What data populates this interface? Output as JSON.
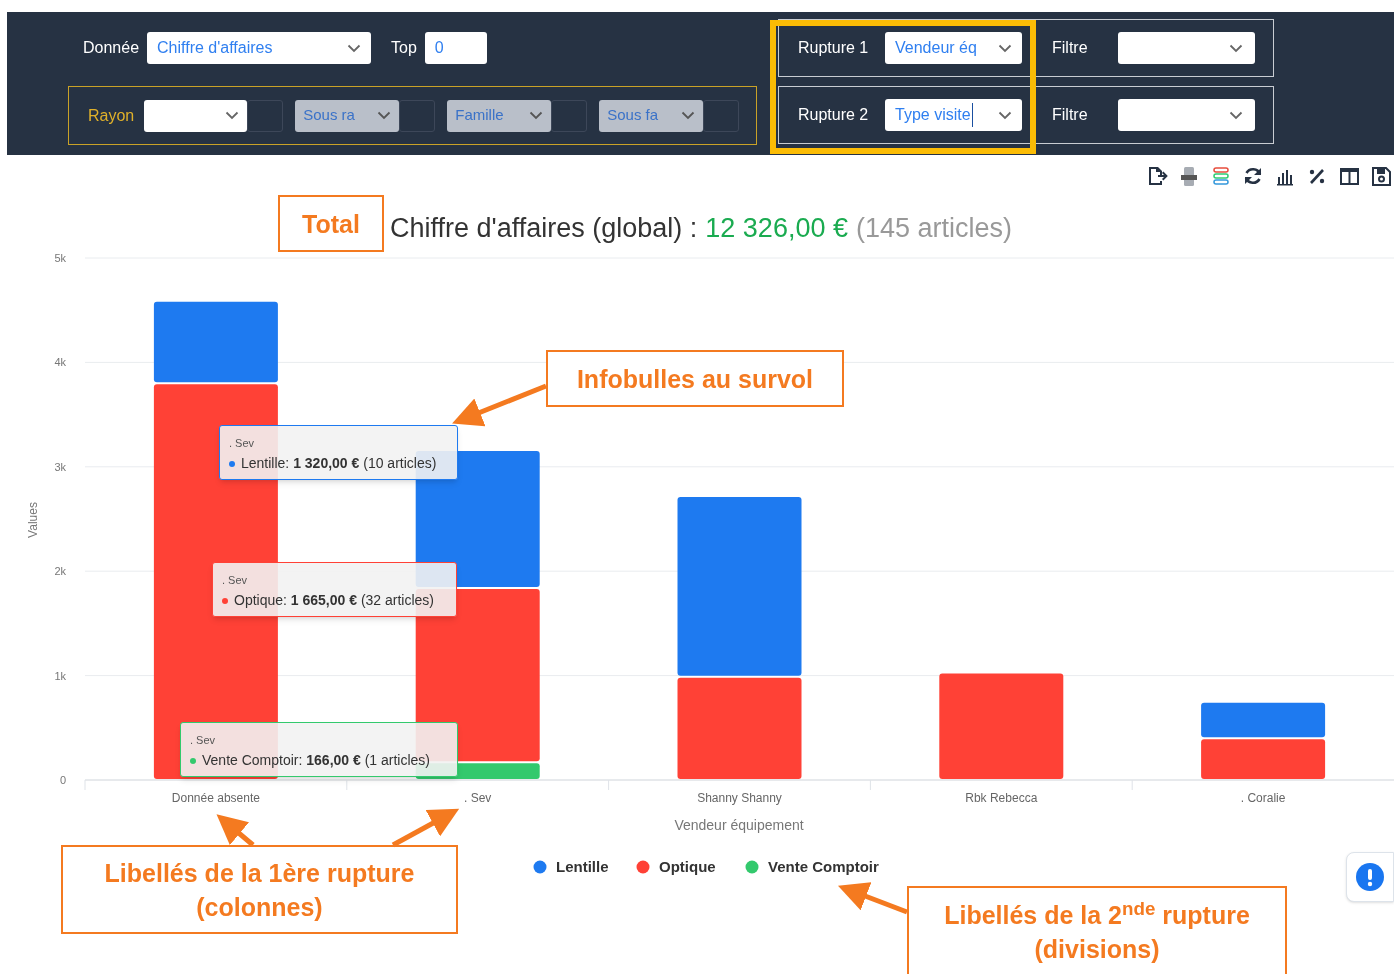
{
  "filters": {
    "donnee": {
      "label": "Donnée",
      "value": "Chiffre d'affaires"
    },
    "top": {
      "label": "Top",
      "value": "0"
    }
  },
  "hierarchy": {
    "label": "Rayon",
    "selects": [
      {
        "disabled": false
      },
      {
        "placeholder": "Sous ra",
        "disabled": true
      },
      {
        "placeholder": "Famille",
        "disabled": true
      },
      {
        "placeholder": "Sous fa",
        "disabled": true
      }
    ]
  },
  "ruptures": [
    {
      "label": "Rupture 1",
      "value": "Vendeur éq",
      "focused": false,
      "filter_label": "Filtre"
    },
    {
      "label": "Rupture 2",
      "value": "Type visite",
      "focused": true,
      "filter_label": "Filtre"
    }
  ],
  "chart": {
    "title": "Chiffre d'affaires (global) :",
    "amount": "12 326,00 €",
    "count": "(145 articles)",
    "chart_data": {
      "type": "bar",
      "stacked": true,
      "grid": true,
      "legend": true,
      "xlabel": "Vendeur équipement",
      "ylabel": "Values",
      "categories": [
        "Donnée absente",
        ". Sev",
        "Shanny Shanny",
        "Rbk Rebecca",
        ". Coralie"
      ],
      "ylim": [
        0,
        5000
      ],
      "yticks": [
        {
          "value": 0,
          "label": "0"
        },
        {
          "value": 1000,
          "label": "1k"
        },
        {
          "value": 2000,
          "label": "2k"
        },
        {
          "value": 3000,
          "label": "3k"
        },
        {
          "value": 4000,
          "label": "4k"
        },
        {
          "value": 5000,
          "label": "5k"
        }
      ],
      "series": [
        {
          "name": "Lentille",
          "color": "#1e7af0",
          "values": [
            790,
            1320,
            1730,
            0,
            350
          ]
        },
        {
          "name": "Optique",
          "color": "#ff4136",
          "values": [
            3800,
            1670,
            990,
            1030,
            400
          ]
        },
        {
          "name": "Vente Comptoir",
          "color": "#33c96d",
          "values": [
            0,
            170,
            0,
            0,
            0
          ]
        }
      ]
    },
    "tooltips": [
      {
        "category": ". Sev",
        "text": "Lentille: **1 320,00 €** (10 articles)",
        "color": "#1e7af0"
      },
      {
        "category": ". Sev",
        "text": "Optique: **1 665,00 €** (32 articles)",
        "color": "#ff4136"
      },
      {
        "category": ". Sev",
        "text": "Vente Comptoir: **166,00 €** (1 articles)",
        "color": "#33c96d"
      }
    ]
  },
  "annotations": [
    {
      "text": "Total"
    },
    {
      "text": "Infobulles au survol"
    },
    {
      "text": "Libellés de la 1ère rupture (colonnes)"
    },
    {
      "text": "Libellés de la 2$^{nde}$ rupture (divisions)"
    }
  ]
}
